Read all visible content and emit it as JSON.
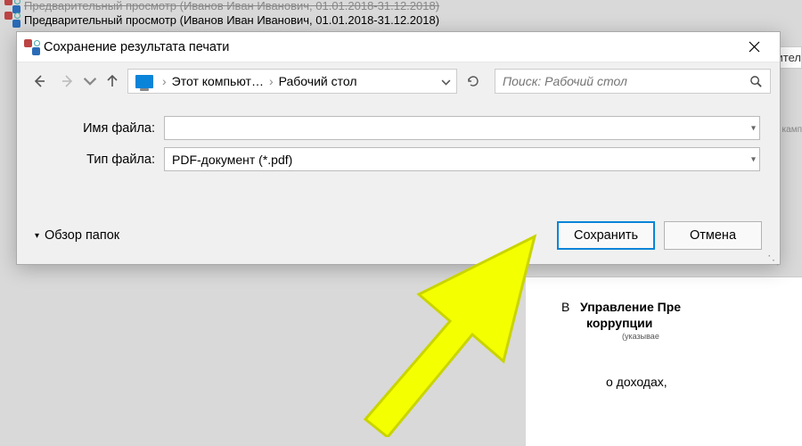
{
  "background": {
    "title_back": "Предварительный просмотр (Иванов Иван Иванович, 01.01.2018-31.12.2018)",
    "title_front": "Предварительный просмотр (Иванов Иван Иванович, 01.01.2018-31.12.2018)",
    "right_label_cut": "нител",
    "right_label_small": "й камп"
  },
  "dialog": {
    "title": "Сохранение результата печати",
    "nav": {
      "breadcrumb_root": "Этот компьют…",
      "breadcrumb_loc": "Рабочий стол"
    },
    "search_placeholder": "Поиск: Рабочий стол",
    "filename_label": "Имя файла:",
    "filename_value": "",
    "filetype_label": "Тип файла:",
    "filetype_value": "PDF-документ (*.pdf)",
    "browse_folders": "Обзор папок",
    "save_btn": "Сохранить",
    "cancel_btn": "Отмена"
  },
  "document": {
    "prefix": "В",
    "line1a": "Управление Пре",
    "line1b": "коррупции",
    "small": "(указывае",
    "line3": "о доходах,"
  }
}
